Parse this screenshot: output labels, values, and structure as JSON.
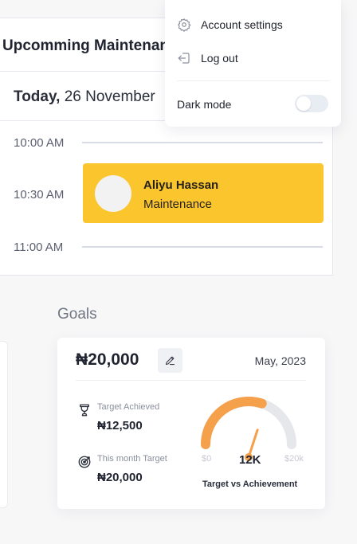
{
  "schedule": {
    "title": "Upcomming Maintenance",
    "date_prefix": "Today,",
    "date": "26 November",
    "times": [
      "10:00 AM",
      "10:30 AM",
      "11:00 AM"
    ],
    "event": {
      "name": "Aliyu Hassan",
      "type": "Maintenance",
      "color": "#fbc52e"
    }
  },
  "menu": {
    "items": [
      {
        "label": "Account settings",
        "icon": "gear-icon"
      },
      {
        "label": "Log out",
        "icon": "logout-icon"
      }
    ],
    "dark_mode_label": "Dark mode",
    "dark_mode_on": false
  },
  "goals": {
    "heading": "Goals",
    "amount": "₦20,000",
    "month": "May, 2023",
    "stats": [
      {
        "label": "Target Achieved",
        "value": "₦12,500",
        "icon": "trophy-icon"
      },
      {
        "label": "This month Target",
        "value": "₦20,000",
        "icon": "target-icon"
      }
    ],
    "gauge": {
      "min_label": "$0",
      "value_label": "12K",
      "max_label": "$20k",
      "caption": "Target vs Achievement",
      "min": 0,
      "max": 20000,
      "value": 12000,
      "accent_color": "#f5a04a",
      "track_color": "#e6e7ea"
    }
  }
}
